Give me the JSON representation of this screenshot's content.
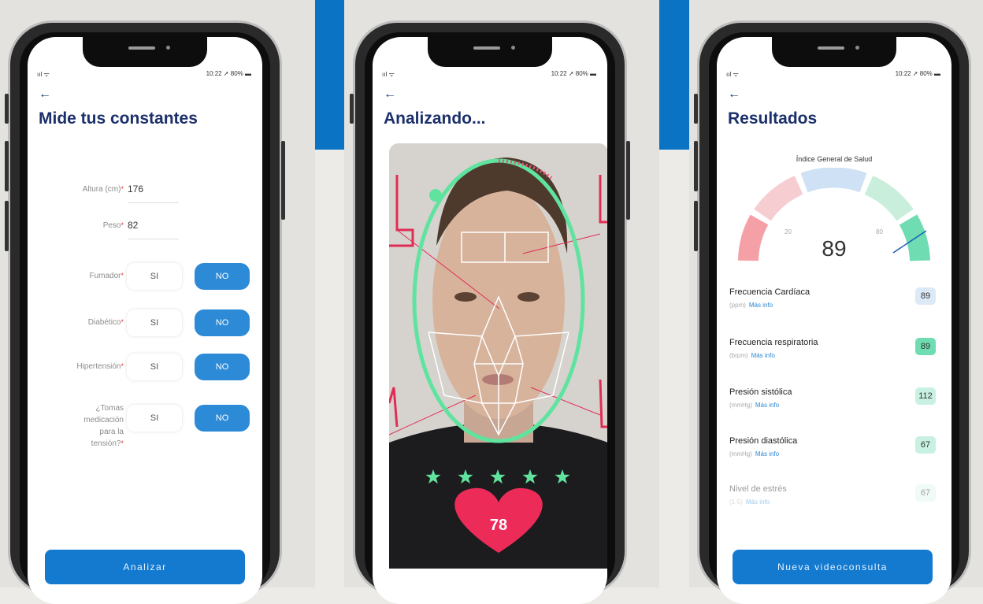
{
  "phones": {
    "form": {
      "status": {
        "signal": "ııl ᯤ",
        "time": "10:22 ➚ 80% ▬"
      },
      "back_icon": "←",
      "title": "Mide tus constantes",
      "fields": [
        {
          "label": "Altura (cm)",
          "required": "*",
          "value": "176"
        },
        {
          "label": "Peso",
          "required": "*",
          "value": "82"
        }
      ],
      "toggles": [
        {
          "label": "Fumador",
          "required": "*",
          "yes": "SI",
          "no": "NO"
        },
        {
          "label": "Diabético",
          "required": "*",
          "yes": "SI",
          "no": "NO"
        },
        {
          "label": "Hipertensión",
          "required": "*",
          "yes": "SI",
          "no": "NO"
        },
        {
          "label": "¿Tomas medicación para la tensión?",
          "required": "*",
          "yes": "SI",
          "no": "NO"
        }
      ],
      "cta": "Analizar"
    },
    "analyze": {
      "status": {
        "signal": "ııl ᯤ",
        "time": "10:22 ➚ 80% ▬"
      },
      "back_icon": "←",
      "title": "Analizando...",
      "stars": 5,
      "heart_value": "78"
    },
    "results": {
      "status": {
        "signal": "ııl ᯤ",
        "time": "10:22 ➚ 80% ▬"
      },
      "back_icon": "←",
      "title": "Resultados",
      "gauge": {
        "title": "Índice General de Salud",
        "min_label": "20",
        "max_label": "80",
        "value": "89"
      },
      "rows": [
        {
          "name": "Frecuencia Cardíaca",
          "unit": "(ppm)",
          "more": "Más info",
          "value": "89",
          "color": "#dce9f7"
        },
        {
          "name": "Frecuencia respiratoria",
          "unit": "(brpm)",
          "more": "Más info",
          "value": "89",
          "color": "#6fdcb1"
        },
        {
          "name": "Presión sistólica",
          "unit": "(mmHg)",
          "more": "Más info",
          "value": "112",
          "color": "#c8f1e2"
        },
        {
          "name": "Presión diastólica",
          "unit": "(mmHg)",
          "more": "Más info",
          "value": "67",
          "color": "#c8f1e2"
        },
        {
          "name": "Nivel de estrés",
          "unit": "(1-5)",
          "more": "Más info",
          "value": "67",
          "color": "#dff5ec"
        }
      ],
      "cta": "Nueva videoconsulta"
    }
  },
  "colors": {
    "brand_blue": "#0a73c4",
    "title_navy": "#1b2f6b",
    "accent_green": "#5fdc9c",
    "heart_pink": "#ec2b59"
  }
}
